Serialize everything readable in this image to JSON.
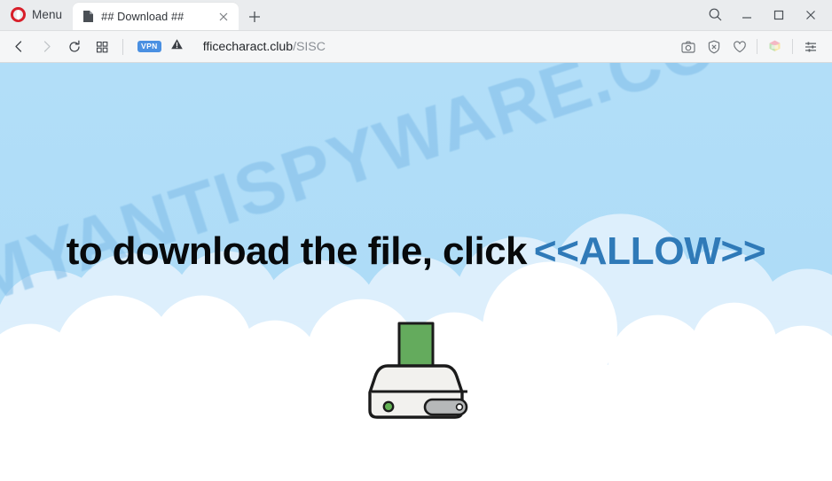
{
  "browser": {
    "menu_label": "Menu",
    "tab": {
      "title": "## Download ##",
      "favicon": "document-icon",
      "close": "close-icon"
    },
    "new_tab": "+",
    "window_controls": {
      "search": "search-icon",
      "minimize": "minimize-icon",
      "maximize": "maximize-icon",
      "close": "close-icon"
    }
  },
  "addressbar": {
    "back": "back-arrow-icon",
    "forward": "forward-arrow-icon",
    "reload": "reload-icon",
    "tabs_overview": "grid-icon",
    "vpn_label": "VPN",
    "security_icon": "warning-triangle-icon",
    "url_domain": "fficecharact.club",
    "url_path": "/SISC",
    "url_full": "fficecharact.club/SISC",
    "actions": [
      {
        "name": "snapshot-icon",
        "label": "Snapshot"
      },
      {
        "name": "ad-blocker-icon",
        "label": "Ad blocker"
      },
      {
        "name": "heart-icon",
        "label": "Add to favorites"
      },
      {
        "name": "extension-cube-icon",
        "label": "Extension"
      },
      {
        "name": "easy-setup-icon",
        "label": "Easy setup"
      }
    ]
  },
  "page": {
    "watermark": "MYANTISPYWARE.COM",
    "headline_prefix": "to download the file, click",
    "headline_allow": "<<ALLOW>>",
    "illustration": "download-drive-icon",
    "colors": {
      "sky": "#aedcf7",
      "cloud": "#ffffff",
      "cloud_back": "#e4f2fc",
      "allow_text": "#2f7ab8",
      "headline_text": "#07090b",
      "arrow_green": "#5fa85a",
      "drive_body": "#f2f1ee",
      "watermark": "#7fbce8"
    }
  }
}
